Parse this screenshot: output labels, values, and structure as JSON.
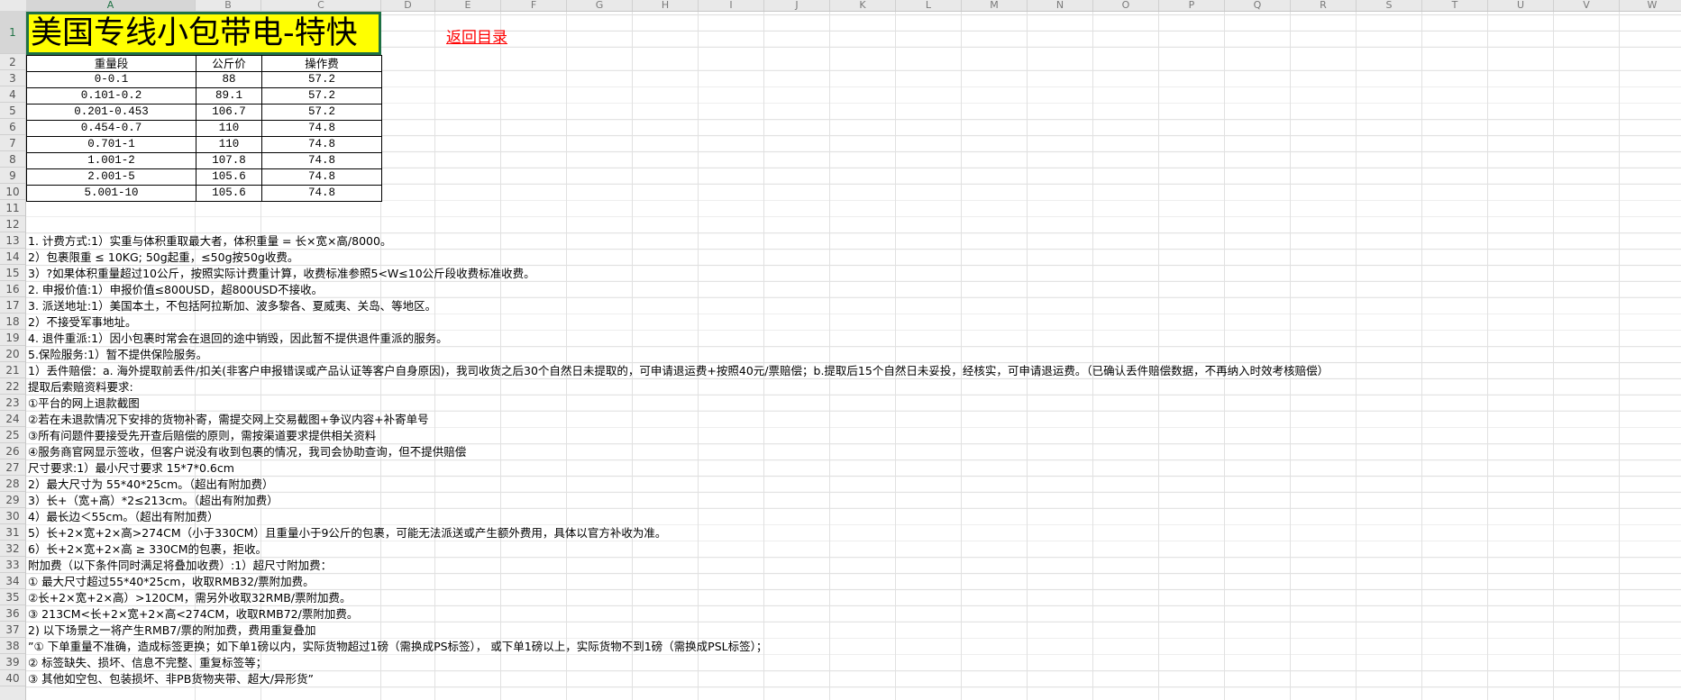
{
  "columns": [
    "A",
    "B",
    "C",
    "D",
    "E",
    "F",
    "G",
    "H",
    "I",
    "J",
    "K",
    "L",
    "M",
    "N",
    "O",
    "P",
    "Q",
    "R",
    "S",
    "T",
    "U",
    "V",
    "W"
  ],
  "rows": [
    "1",
    "2",
    "3",
    "4",
    "5",
    "6",
    "7",
    "8",
    "9",
    "10",
    "11",
    "12",
    "13",
    "14",
    "15",
    "16",
    "17",
    "18",
    "19",
    "20",
    "21",
    "22",
    "23",
    "24",
    "25",
    "26",
    "27",
    "28",
    "29",
    "30",
    "31",
    "32",
    "33",
    "34",
    "35",
    "36",
    "37",
    "38",
    "39",
    "40"
  ],
  "title": "美国专线小包带电-特快",
  "back_link": "返回目录",
  "table": {
    "headers": [
      "重量段",
      "公斤价",
      "操作费"
    ],
    "rows": [
      [
        "0-0.1",
        "88",
        "57.2"
      ],
      [
        "0.101-0.2",
        "89.1",
        "57.2"
      ],
      [
        "0.201-0.453",
        "106.7",
        "57.2"
      ],
      [
        "0.454-0.7",
        "110",
        "74.8"
      ],
      [
        "0.701-1",
        "110",
        "74.8"
      ],
      [
        "1.001-2",
        "107.8",
        "74.8"
      ],
      [
        "2.001-5",
        "105.6",
        "74.8"
      ],
      [
        "5.001-10",
        "105.6",
        "74.8"
      ]
    ]
  },
  "notes": [
    "",
    "1. 计费方式:1）实重与体积重取最大者，体积重量 = 长×宽×高/8000。",
    "2）包裹限重 ≤ 10KG;  50g起重，≤50g按50g收费。",
    "3）?如果体积重量超过10公斤，按照实际计费重计算，收费标准参照5<W≤10公斤段收费标准收费。",
    "2. 申报价值:1）申报价值≤800USD，超800USD不接收。",
    "3. 派送地址:1）美国本土，不包括阿拉斯加、波多黎各、夏威夷、关岛、等地区。",
    "2）不接受军事地址。",
    "4. 退件重派:1）因小包裹时常会在退回的途中销毁，因此暂不提供退件重派的服务。",
    "5.保险服务:1）暂不提供保险服务。",
    "1）丢件赔偿：a. 海外提取前丢件/扣关(非客户申报错误或产品认证等客户自身原因)，我司收货之后30个自然日未提取的，可申请退运费+按照40元/票赔偿；b.提取后15个自然日未妥投，经核实，可申请退运费。（已确认丢件赔偿数据，不再纳入时效考核赔偿）",
    "提取后索赔资料要求:",
    "①平台的网上退款截图",
    "②若在未退款情况下安排的货物补寄，需提交网上交易截图+争议内容+补寄单号",
    "③所有问题件要接受先开查后赔偿的原则，需按渠道要求提供相关资料",
    "④服务商官网显示签收，但客户说没有收到包裹的情况，我司会协助查询，但不提供赔偿",
    "尺寸要求:1）最小尺寸要求 15*7*0.6cm",
    "2）最大尺寸为 55*40*25cm。（超出有附加费）",
    "3）长+（宽+高）*2≤213cm。（超出有附加费）",
    "4）最长边＜55cm。（超出有附加费）",
    "5）长+2×宽+2×高>274CM（小于330CM）且重量小于9公斤的包裹，可能无法派送或产生额外费用，具体以官方补收为准。",
    "6）长+2×宽+2×高 ≥ 330CM的包裹，拒收。",
    "附加费（以下条件同时满足将叠加收费）:1）超尺寸附加费：",
    "① 最大尺寸超过55*40*25cm，收取RMB32/票附加费。",
    "②长+2×宽+2×高）>120CM，需另外收取32RMB/票附加费。",
    "③ 213CM<长+2×宽+2×高<274CM，收取RMB72/票附加费。",
    "2)  以下场景之一将产生RMB7/票的附加费，费用重复叠加",
    "”① 下单重量不准确，造成标签更换；如下单1磅以内，实际货物超过1磅（需换成PS标签）， 或下单1磅以上，实际货物不到1磅（需换成PSL标签）；",
    "② 标签缺失、损坏、信息不完整、重复标签等；",
    "③ 其他如空包、包装损坏、非PB货物夹带、超大/异形货”"
  ],
  "colors": {
    "title_fill": "#ffff00",
    "selection_border": "#1e7145",
    "link": "#ff0000",
    "gridline": "#e1e1e1",
    "header_bg": "#e9e9e9"
  }
}
